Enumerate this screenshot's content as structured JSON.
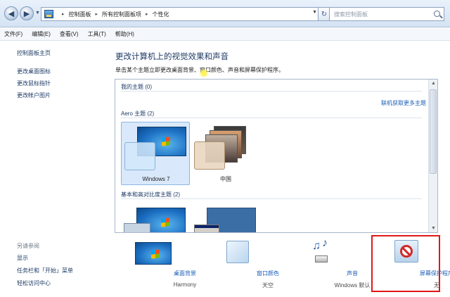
{
  "address": {
    "path": [
      "控制面板",
      "所有控制面板项",
      "个性化"
    ],
    "search_placeholder": "搜索控制面板"
  },
  "menu": [
    "文件(F)",
    "编辑(E)",
    "查看(V)",
    "工具(T)",
    "帮助(H)"
  ],
  "sidebar": {
    "links": [
      "控制面板主页",
      "更改桌面图标",
      "更改鼠标指针",
      "更改帐户图片"
    ],
    "see_also_title": "另请参阅",
    "see_also": [
      "显示",
      "任务栏和「开始」菜单",
      "轻松访问中心"
    ]
  },
  "main": {
    "title": "更改计算机上的视觉效果和声音",
    "description": "单击某个主题立即更改桌面背景、窗口颜色、声音和屏幕保护程序。"
  },
  "themes": {
    "my_themes_label": "我的主题 (0)",
    "online_link": "联机获取更多主题",
    "aero_label": "Aero 主题 (2)",
    "aero_items": [
      "Windows 7",
      "中国"
    ],
    "basic_label": "基本和高对比度主题 (2)"
  },
  "bottom": {
    "items": [
      {
        "label": "桌面背景",
        "value": "Harmony"
      },
      {
        "label": "窗口颜色",
        "value": "天空"
      },
      {
        "label": "声音",
        "value": "Windows 默认"
      },
      {
        "label": "屏幕保护程序",
        "value": "无"
      }
    ]
  },
  "colors": {
    "highlight": "#e01818",
    "link": "#1a5db5",
    "selected_tile": "#d9e9fb"
  }
}
